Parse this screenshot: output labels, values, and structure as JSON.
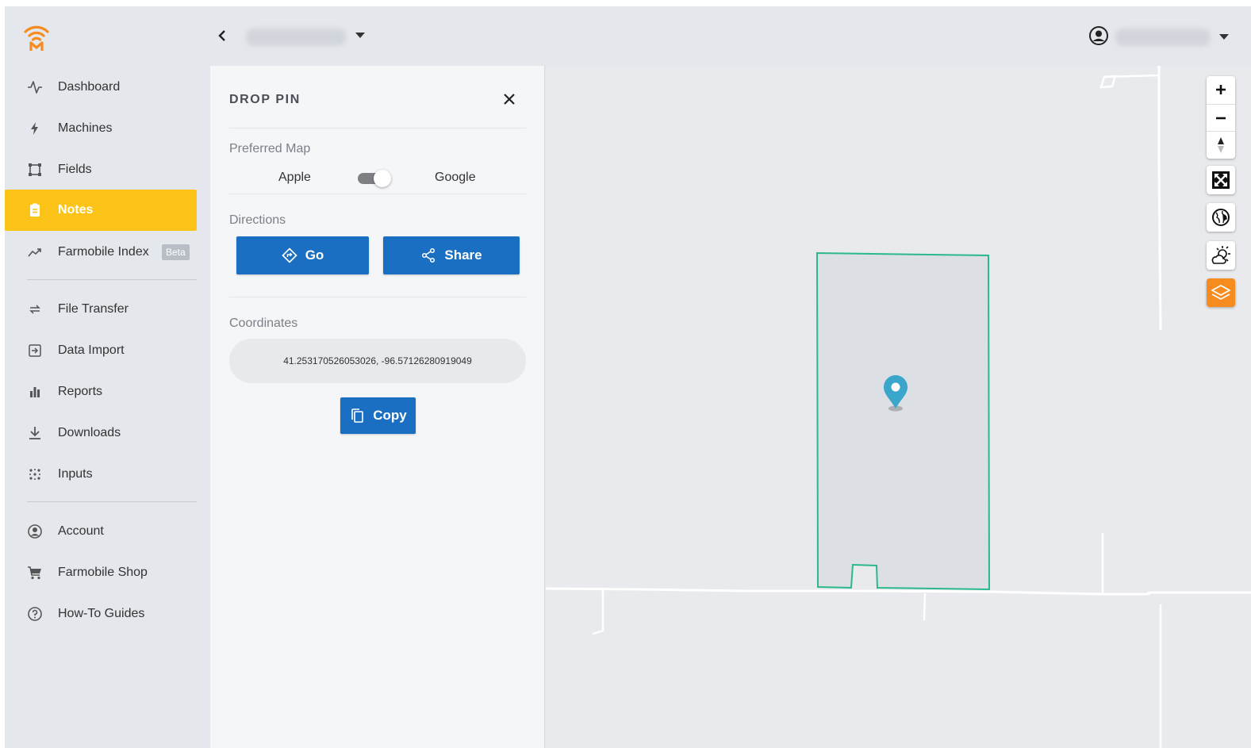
{
  "sidebar": {
    "items": [
      {
        "label": "Dashboard",
        "icon": "activity-icon"
      },
      {
        "label": "Machines",
        "icon": "bolt-icon"
      },
      {
        "label": "Fields",
        "icon": "field-shape-icon"
      },
      {
        "label": "Notes",
        "icon": "clipboard-icon"
      },
      {
        "label": "Farmobile Index",
        "icon": "trend-icon",
        "badge": "Beta"
      },
      {
        "label": "File Transfer",
        "icon": "transfer-icon"
      },
      {
        "label": "Data Import",
        "icon": "import-icon"
      },
      {
        "label": "Reports",
        "icon": "bar-chart-icon"
      },
      {
        "label": "Downloads",
        "icon": "download-icon"
      },
      {
        "label": "Inputs",
        "icon": "dots-icon"
      },
      {
        "label": "Account",
        "icon": "account-icon"
      },
      {
        "label": "Farmobile Shop",
        "icon": "cart-icon"
      },
      {
        "label": "How-To Guides",
        "icon": "help-icon"
      }
    ],
    "active": "Notes"
  },
  "panel": {
    "title": "DROP PIN",
    "preferred_map_label": "Preferred Map",
    "option_left": "Apple",
    "option_right": "Google",
    "toggle_selected": "Google",
    "directions_label": "Directions",
    "go_label": "Go",
    "share_label": "Share",
    "coordinates_label": "Coordinates",
    "coordinates_value": "41.253170526053026, -96.57126280919049",
    "copy_label": "Copy"
  },
  "colors": {
    "accent": "#fcc419",
    "primary_button": "#1b6fc2",
    "field_outline": "#2bb88a",
    "pin": "#3aa6cc",
    "layers_button": "#f68b1f",
    "brand_orange": "#f68b1f"
  }
}
